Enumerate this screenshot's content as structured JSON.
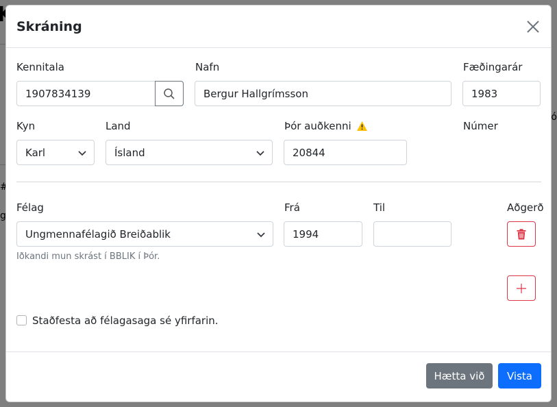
{
  "background": {
    "letter_k": "K",
    "hash": "#",
    "letter_g": "g",
    "edge_text": "Só"
  },
  "modal": {
    "title": "Skráning"
  },
  "form": {
    "kennitala": {
      "label": "Kennitala",
      "value": "1907834139"
    },
    "nafn": {
      "label": "Nafn",
      "value": "Bergur Hallgrímsson"
    },
    "faedingarar": {
      "label": "Fæðingarár",
      "value": "1983"
    },
    "kyn": {
      "label": "Kyn",
      "value": "Karl"
    },
    "land": {
      "label": "Land",
      "value": "Ísland"
    },
    "thor_audkenni": {
      "label": "Þór auðkenni",
      "value": "20844"
    },
    "numer": {
      "label": "Númer"
    }
  },
  "club": {
    "felag_label": "Félag",
    "fra_label": "Frá",
    "til_label": "Til",
    "adgerd_label": "Aðgerð",
    "felag_value": "Ungmennafélagið Breiðablik",
    "fra_value": "1994",
    "til_value": "",
    "help_text": "Iðkandi mun skrást í BBLIK í Þór."
  },
  "confirm_label": "Staðfesta að félagasaga sé yfirfarin.",
  "footer": {
    "cancel_label": "Hætta við",
    "save_label": "Vista"
  },
  "colors": {
    "primary": "#0d6efd",
    "secondary": "#6c757d",
    "danger": "#dc3545",
    "warning": "#ffc107"
  },
  "icons": [
    "close-icon",
    "search-icon",
    "chevron-down-icon",
    "warning-icon",
    "trash-icon",
    "plus-icon"
  ]
}
